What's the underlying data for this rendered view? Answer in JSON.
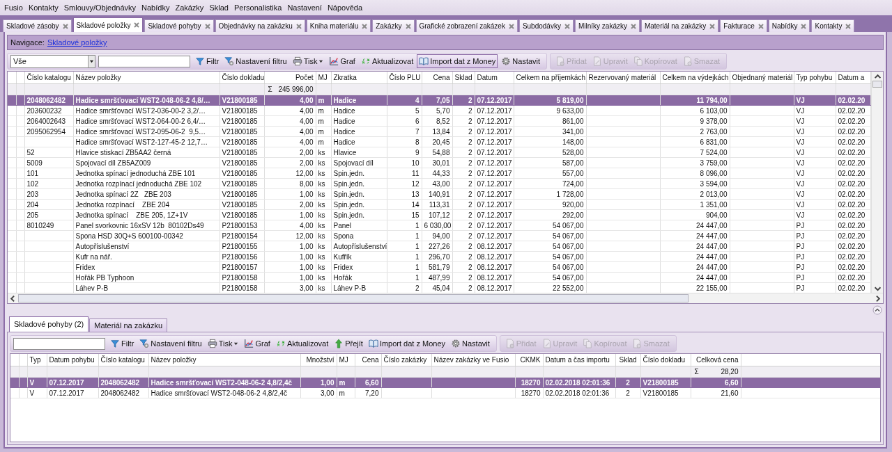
{
  "menu": [
    "Fusio",
    "Kontakty",
    "Smlouvy/Objednávky",
    "Nabídky",
    "Zakázky",
    "Sklad",
    "Personalistika",
    "Nastavení",
    "Nápověda"
  ],
  "tabs": [
    {
      "label": "Skladové zásoby",
      "selected": false
    },
    {
      "label": "Skladové položky",
      "selected": true
    },
    {
      "label": "Skladové pohyby",
      "selected": false
    },
    {
      "label": "Objednávky na zakázku",
      "selected": false
    },
    {
      "label": "Kniha materiálu",
      "selected": false
    },
    {
      "label": "Zakázky",
      "selected": false
    },
    {
      "label": "Grafické zobrazení zakázek",
      "selected": false
    },
    {
      "label": "Subdodávky",
      "selected": false
    },
    {
      "label": "Milníky zakázky",
      "selected": false
    },
    {
      "label": "Materiál na zakázky",
      "selected": false
    },
    {
      "label": "Fakturace",
      "selected": false
    },
    {
      "label": "Nabídky",
      "selected": false
    },
    {
      "label": "Kontakty",
      "selected": false
    }
  ],
  "navigation": {
    "label": "Navigace:",
    "link": "Skladové položky"
  },
  "toolbar": {
    "combo": "Vše",
    "buttons": [
      {
        "label": "Filtr",
        "kind": "filter",
        "has_menu": false,
        "pressed": false,
        "disabled": false
      },
      {
        "label": "Nastavení filtru",
        "kind": "filter-settings",
        "has_menu": false,
        "pressed": false,
        "disabled": false
      },
      {
        "label": "Tisk",
        "kind": "print",
        "has_menu": true,
        "pressed": false,
        "disabled": false
      },
      {
        "label": "Graf",
        "kind": "chart",
        "has_menu": false,
        "pressed": false,
        "disabled": false
      },
      {
        "label": "Aktualizovat",
        "kind": "refresh",
        "has_menu": false,
        "pressed": false,
        "disabled": false
      },
      {
        "label": "Import dat z Money",
        "kind": "import",
        "has_menu": false,
        "pressed": true,
        "disabled": false
      },
      {
        "label": "Nastavit",
        "kind": "settings",
        "has_menu": false,
        "pressed": false,
        "disabled": false
      }
    ],
    "edit_buttons": [
      {
        "label": "Přidat",
        "kind": "add",
        "disabled": true
      },
      {
        "label": "Upravit",
        "kind": "edit",
        "disabled": true
      },
      {
        "label": "Kopírovat",
        "kind": "copy",
        "disabled": true
      },
      {
        "label": "Smazat",
        "kind": "delete",
        "disabled": true
      }
    ]
  },
  "top_grid": {
    "columns": [
      {
        "label": "Číslo katalogu"
      },
      {
        "label": "Název položky"
      },
      {
        "label": "Číslo dokladu"
      },
      {
        "label": "Počet",
        "total_sign": "Σ",
        "total": "245 996,00"
      },
      {
        "label": "MJ"
      },
      {
        "label": "Zkratka"
      },
      {
        "label": "Číslo PLU"
      },
      {
        "label": "Cena"
      },
      {
        "label": "Sklad"
      },
      {
        "label": "Datum"
      },
      {
        "label": "Celkem na příjemkách"
      },
      {
        "label": "Rezervovaný materiál"
      },
      {
        "label": "Celkem na výdejkách"
      },
      {
        "label": "Objednaný materiál"
      },
      {
        "label": "Typ pohybu"
      },
      {
        "label": "Datum a"
      }
    ],
    "rows": [
      {
        "selected": true,
        "cells": [
          "2048062482",
          "Hadice smršťovací WST2-048-06-2 4,8/…",
          "V21800185",
          "4,00",
          "m",
          "Hadice",
          "4",
          "7,05",
          "2",
          "07.12.2017",
          "5 819,00",
          null,
          "11 794,00",
          null,
          "VJ",
          "02.02.20"
        ]
      },
      {
        "selected": false,
        "cells": [
          "203600232",
          "Hadice smršťovací WST2-036-00-2 3,2/…",
          "V21800185",
          "4,00",
          "m",
          "Hadice",
          "5",
          "5,70",
          "2",
          "07.12.2017",
          "9 633,00",
          null,
          "6 103,00",
          null,
          "VJ",
          "02.02.20"
        ]
      },
      {
        "selected": false,
        "cells": [
          "2064002643",
          "Hadice smršťovací WST2-064-00-2 6,4/…",
          "V21800185",
          "4,00",
          "m",
          "Hadice",
          "6",
          "8,52",
          "2",
          "07.12.2017",
          "861,00",
          null,
          "9 378,00",
          null,
          "VJ",
          "02.02.20"
        ]
      },
      {
        "selected": false,
        "cells": [
          "2095062954",
          "Hadice smršťovací WST2-095-06-2  9,5…",
          "V21800185",
          "4,00",
          "m",
          "Hadice",
          "7",
          "13,84",
          "2",
          "07.12.2017",
          "341,00",
          null,
          "2 763,00",
          null,
          "VJ",
          "02.02.20"
        ]
      },
      {
        "selected": false,
        "cells": [
          null,
          "Hadice smršťovací WST2-127-45-2 12,7…",
          "V21800185",
          "4,00",
          "m",
          "Hadice",
          "8",
          "20,45",
          "2",
          "07.12.2017",
          "148,00",
          null,
          "6 831,00",
          null,
          "VJ",
          "02.02.20"
        ]
      },
      {
        "selected": false,
        "cells": [
          "52",
          "Hlavice stiskací ZB5AA2 černá",
          "V21800185",
          "2,00",
          "ks",
          "Hlavice",
          "9",
          "54,88",
          "2",
          "07.12.2017",
          "528,00",
          null,
          "7 524,00",
          null,
          "VJ",
          "02.02.20"
        ]
      },
      {
        "selected": false,
        "cells": [
          "5009",
          "Spojovací díl ZB5AZ009",
          "V21800185",
          "2,00",
          "ks",
          "Spojovací díl",
          "10",
          "30,01",
          "2",
          "07.12.2017",
          "587,00",
          null,
          "3 759,00",
          null,
          "VJ",
          "02.02.20"
        ]
      },
      {
        "selected": false,
        "cells": [
          "101",
          "Jednotka spínací jednoduchá ZBE 101",
          "V21800185",
          "12,00",
          "ks",
          "Spin.jedn.",
          "11",
          "44,33",
          "2",
          "07.12.2017",
          "557,00",
          null,
          "8 096,00",
          null,
          "VJ",
          "02.02.20"
        ]
      },
      {
        "selected": false,
        "cells": [
          "102",
          "Jednotka rozpínací jednoduchá ZBE 102",
          "V21800185",
          "8,00",
          "ks",
          "Spin.jedn.",
          "12",
          "43,00",
          "2",
          "07.12.2017",
          "724,00",
          null,
          "3 594,00",
          null,
          "VJ",
          "02.02.20"
        ]
      },
      {
        "selected": false,
        "cells": [
          "203",
          "Jednotka spínací 2Z   ZBE 203",
          "V21800185",
          "1,00",
          "ks",
          "Spin.jedn.",
          "13",
          "140,91",
          "2",
          "07.12.2017",
          "1 728,00",
          null,
          "2 013,00",
          null,
          "VJ",
          "02.02.20"
        ]
      },
      {
        "selected": false,
        "cells": [
          "204",
          "Jednotka rozpínací    ZBE 204",
          "V21800185",
          "2,00",
          "ks",
          "Spin.jedn.",
          "14",
          "113,31",
          "2",
          "07.12.2017",
          "920,00",
          null,
          "1 351,00",
          null,
          "VJ",
          "02.02.20"
        ]
      },
      {
        "selected": false,
        "cells": [
          "205",
          "Jednotka spínací    ZBE 205, 1Z+1V",
          "V21800185",
          "1,00",
          "ks",
          "Spin.jedn.",
          "15",
          "107,12",
          "2",
          "07.12.2017",
          "292,00",
          null,
          "904,00",
          null,
          "VJ",
          "02.02.20"
        ]
      },
      {
        "selected": false,
        "cells": [
          "8010249",
          "Panel svorkovnic 16xSV 12b  80102Ds49",
          "P21800153",
          "4,00",
          "ks",
          "Panel",
          "1",
          "6 030,00",
          "2",
          "07.12.2017",
          "54 067,00",
          null,
          "24 447,00",
          null,
          "PJ",
          "02.02.20"
        ]
      },
      {
        "selected": false,
        "cells": [
          null,
          "Spona HSD 30Q+S 600100-00342",
          "P21800154",
          "12,00",
          "ks",
          "Spona",
          "1",
          "94,00",
          "2",
          "07.12.2017",
          "54 067,00",
          null,
          "24 447,00",
          null,
          "PJ",
          "02.02.20"
        ]
      },
      {
        "selected": false,
        "cells": [
          null,
          "Autopříslušenství",
          "P21800155",
          "1,00",
          "ks",
          "Autopříslušenství",
          "1",
          "227,26",
          "2",
          "08.12.2017",
          "54 067,00",
          null,
          "24 447,00",
          null,
          "PJ",
          "02.02.20"
        ]
      },
      {
        "selected": false,
        "cells": [
          null,
          "Kufr na nář.",
          "P21800156",
          "1,00",
          "ks",
          "Kufřík",
          "1",
          "296,70",
          "2",
          "08.12.2017",
          "54 067,00",
          null,
          "24 447,00",
          null,
          "PJ",
          "02.02.20"
        ]
      },
      {
        "selected": false,
        "cells": [
          null,
          "Fridex",
          "P21800157",
          "1,00",
          "ks",
          "Fridex",
          "1",
          "581,79",
          "2",
          "08.12.2017",
          "54 067,00",
          null,
          "24 447,00",
          null,
          "PJ",
          "02.02.20"
        ]
      },
      {
        "selected": false,
        "cells": [
          null,
          "Hořák PB Typhoon",
          "P21800158",
          "1,00",
          "ks",
          "Hořák",
          "1",
          "487,99",
          "2",
          "08.12.2017",
          "54 067,00",
          null,
          "24 447,00",
          null,
          "PJ",
          "02.02.20"
        ]
      },
      {
        "selected": false,
        "cells": [
          null,
          "Láhev P-B",
          "P21800158",
          "3,00",
          "ks",
          "Láhev P-B",
          "2",
          "45,04",
          "2",
          "08.12.2017",
          "22 552,00",
          null,
          "22 155,00",
          null,
          "PJ",
          "02.02.20"
        ]
      }
    ]
  },
  "bottom_tabs": [
    {
      "label": "Skladové pohyby (2)",
      "selected": true
    },
    {
      "label": "Materiál na zakázku",
      "selected": false
    }
  ],
  "bottom_toolbar": {
    "buttons": [
      {
        "label": "Filtr",
        "kind": "filter",
        "has_menu": false,
        "pressed": false,
        "disabled": false
      },
      {
        "label": "Nastavení filtru",
        "kind": "filter-settings",
        "has_menu": false,
        "pressed": false,
        "disabled": false
      },
      {
        "label": "Tisk",
        "kind": "print",
        "has_menu": true,
        "pressed": false,
        "disabled": false
      },
      {
        "label": "Graf",
        "kind": "chart",
        "has_menu": false,
        "pressed": false,
        "disabled": false
      },
      {
        "label": "Aktualizovat",
        "kind": "refresh",
        "has_menu": false,
        "pressed": false,
        "disabled": false
      },
      {
        "label": "Přejít",
        "kind": "goto",
        "has_menu": false,
        "pressed": false,
        "disabled": false
      },
      {
        "label": "Import dat z Money",
        "kind": "import",
        "has_menu": false,
        "pressed": false,
        "disabled": false
      },
      {
        "label": "Nastavit",
        "kind": "settings",
        "has_menu": false,
        "pressed": false,
        "disabled": false
      }
    ],
    "edit_buttons": [
      {
        "label": "Přidat",
        "kind": "add",
        "disabled": true
      },
      {
        "label": "Upravit",
        "kind": "edit",
        "disabled": true
      },
      {
        "label": "Kopírovat",
        "kind": "copy",
        "disabled": true
      },
      {
        "label": "Smazat",
        "kind": "delete",
        "disabled": true
      }
    ]
  },
  "bottom_grid": {
    "columns": [
      {
        "label": "Typ"
      },
      {
        "label": "Datum pohybu"
      },
      {
        "label": "Číslo katalogu"
      },
      {
        "label": "Název položky"
      },
      {
        "label": "Množství"
      },
      {
        "label": "MJ"
      },
      {
        "label": "Cena"
      },
      {
        "label": "Číslo zakázky"
      },
      {
        "label": "Název zakázky ve Fusio"
      },
      {
        "label": "CKMK"
      },
      {
        "label": "Datum a čas importu"
      },
      {
        "label": "Sklad"
      },
      {
        "label": "Číslo dokladu"
      },
      {
        "label": "Celková cena",
        "total_sign": "Σ",
        "total": "28,20"
      }
    ],
    "rows": [
      {
        "selected": true,
        "cells": [
          "V",
          "07.12.2017",
          "2048062482",
          "Hadice smršťovací WST2-048-06-2 4,8/2,4č",
          "1,00",
          "m",
          "6,60",
          null,
          null,
          "18270",
          "02.02.2018 02:01:36",
          "2",
          "V21800185",
          "6,60"
        ]
      },
      {
        "selected": false,
        "cells": [
          "V",
          "07.12.2017",
          "2048062482",
          "Hadice smršťovací WST2-048-06-2 4,8/2,4č",
          "3,00",
          "m",
          "7,20",
          null,
          null,
          "18270",
          "02.02.2018 02:01:36",
          "2",
          "V21800185",
          "21,60"
        ]
      }
    ]
  }
}
